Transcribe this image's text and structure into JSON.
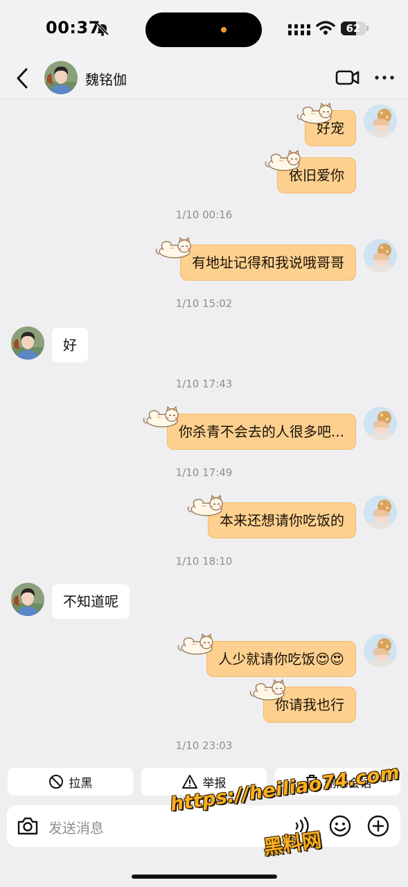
{
  "status_bar": {
    "time": "00:37",
    "battery": "62",
    "battery_level": 0.62
  },
  "header": {
    "contact_name": "魏铭伽"
  },
  "messages": [
    {
      "type": "out",
      "text": "好宠"
    },
    {
      "type": "out",
      "text": "依旧爱你"
    },
    {
      "type": "time",
      "text": "1/10 00:16"
    },
    {
      "type": "out",
      "text": "有地址记得和我说哦哥哥"
    },
    {
      "type": "time",
      "text": "1/10 15:02"
    },
    {
      "type": "in",
      "text": "好"
    },
    {
      "type": "time",
      "text": "1/10 17:43"
    },
    {
      "type": "out",
      "text": "你杀青不会去的人很多吧..."
    },
    {
      "type": "time",
      "text": "1/10 17:49"
    },
    {
      "type": "out",
      "text": "本来还想请你吃饭的"
    },
    {
      "type": "time",
      "text": "1/10 18:10"
    },
    {
      "type": "in",
      "text": "不知道呢"
    },
    {
      "type": "out",
      "text": "人少就请你吃饭😍😍"
    },
    {
      "type": "out",
      "text": "你请我也行"
    },
    {
      "type": "time",
      "text": "1/10 23:03"
    }
  ],
  "actions": {
    "block": "拉黑",
    "report": "举报",
    "delete": "删除会话"
  },
  "input": {
    "placeholder": "发送消息"
  },
  "watermark": {
    "line1": "https://heiliao74.com",
    "line2": "黑料网"
  },
  "colors": {
    "outgoing_bubble": "#fdd090",
    "outgoing_border": "#f3b867",
    "incoming_bubble": "#ffffff",
    "background": "#efeff1"
  },
  "icons": [
    "bell-slash-icon",
    "signal-icon",
    "wifi-icon",
    "back-chevron-icon",
    "video-camera-icon",
    "more-dots-icon",
    "block-icon",
    "warning-icon",
    "trash-icon",
    "camera-icon",
    "voice-icon",
    "emoji-icon",
    "plus-circle-icon",
    "cat-sticker-icon"
  ]
}
